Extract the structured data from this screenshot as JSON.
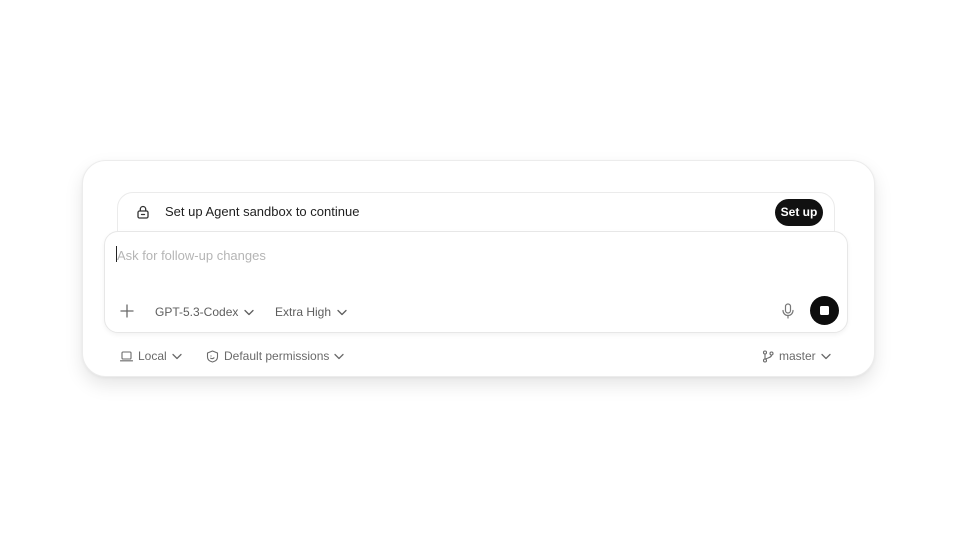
{
  "banner": {
    "icon": "lock-icon",
    "text": "Set up Agent sandbox to continue",
    "button_label": "Set up"
  },
  "composer": {
    "placeholder": "Ask for follow-up changes",
    "value": "",
    "add_icon": "plus-icon",
    "model_label": "GPT-5.3-Codex",
    "effort_label": "Extra High",
    "mic_icon": "microphone-icon",
    "stop_icon": "stop-icon"
  },
  "footer": {
    "environment_label": "Local",
    "environment_icon": "laptop-icon",
    "permissions_label": "Default permissions",
    "permissions_icon": "shield-icon",
    "branch_label": "master",
    "branch_icon": "git-branch-icon"
  },
  "colors": {
    "button_dark": "#111111",
    "placeholder": "#b5b5b5",
    "muted_text": "#5e5e5e"
  }
}
